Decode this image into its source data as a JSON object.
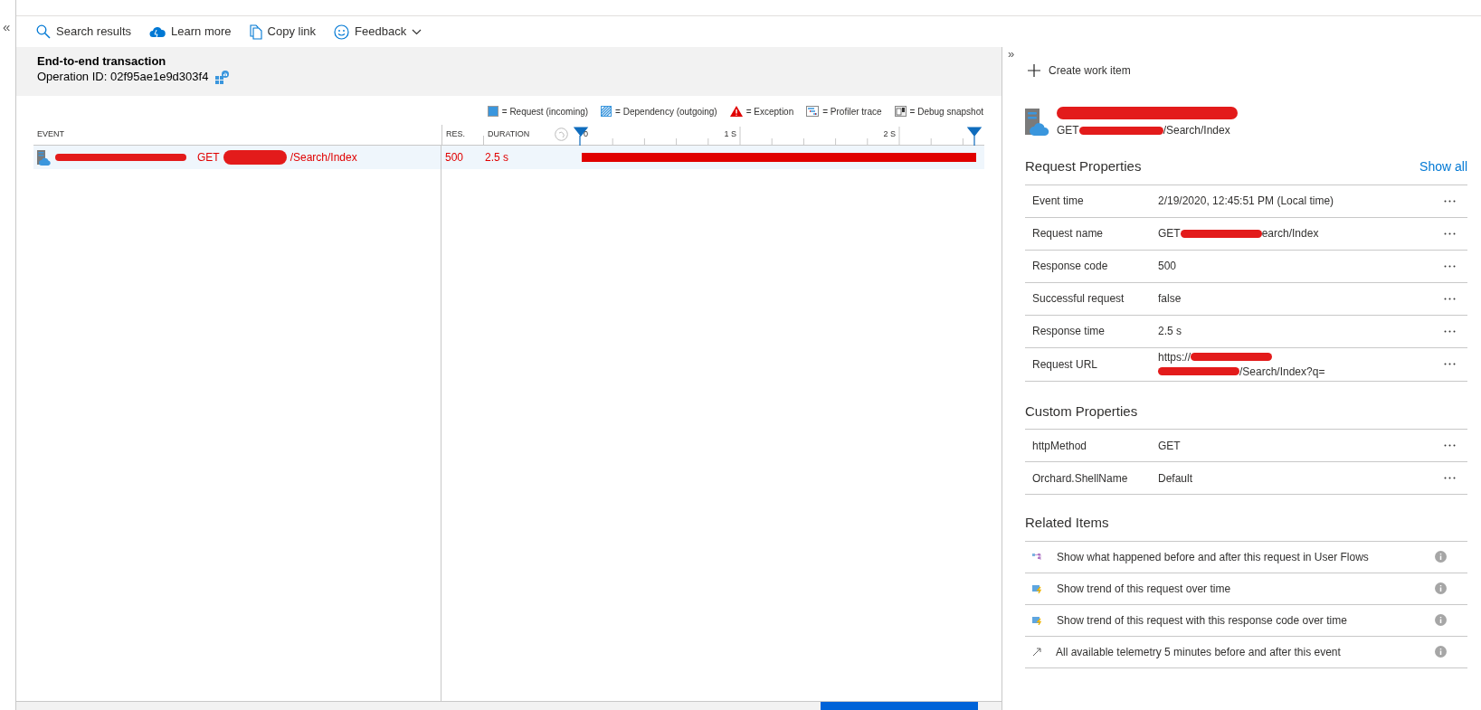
{
  "collapse_left": "«",
  "toolbar": [
    {
      "kind": "search",
      "label": "Search results"
    },
    {
      "kind": "learn",
      "label": "Learn more"
    },
    {
      "kind": "copy",
      "label": "Copy link"
    },
    {
      "kind": "feedback",
      "label": "Feedback"
    }
  ],
  "header": {
    "title": "End-to-end transaction",
    "operation_id": "Operation ID: 02f95ae1e9d303f4"
  },
  "legend": [
    {
      "kind": "request",
      "label": "= Request (incoming)"
    },
    {
      "kind": "dependency",
      "label": "= Dependency (outgoing)"
    },
    {
      "kind": "exception",
      "label": "= Exception"
    },
    {
      "kind": "profiler",
      "label": "= Profiler trace"
    },
    {
      "kind": "snapshot",
      "label": "= Debug snapshot"
    }
  ],
  "table": {
    "columns": [
      "EVENT",
      "RES.",
      "DURATION"
    ],
    "timeline_ticks": [
      "0",
      "1 S",
      "2 S"
    ],
    "rows": [
      {
        "event": [
          {
            "kind": "redacted"
          },
          {
            "kind": "text",
            "text": "GET"
          },
          {
            "kind": "redacted"
          },
          {
            "kind": "text",
            "text": "/Search/Index"
          }
        ],
        "res": "500",
        "duration": "2.5 s",
        "failed": true
      }
    ]
  },
  "details": {
    "expand": "»",
    "create": "Create work item",
    "title": [
      {
        "kind": "redacted"
      }
    ],
    "subtitle": [
      {
        "kind": "text",
        "text": "GET"
      },
      {
        "kind": "redacted"
      },
      {
        "kind": "text",
        "text": "/Search/Index"
      }
    ],
    "sections": [
      {
        "title": "Request Properties",
        "action": "Show all",
        "rows": [
          {
            "label": "Event time",
            "value": [
              [
                {
                  "kind": "text",
                  "text": "2/19/2020, 12:45:51 PM (Local time)"
                }
              ]
            ]
          },
          {
            "label": "Request name",
            "value": [
              [
                {
                  "kind": "text",
                  "text": "GET"
                },
                {
                  "kind": "redacted"
                },
                {
                  "kind": "text",
                  "text": "earch/Index"
                }
              ]
            ]
          },
          {
            "label": "Response code",
            "value": [
              [
                {
                  "kind": "text",
                  "text": "500"
                }
              ]
            ]
          },
          {
            "label": "Successful request",
            "value": [
              [
                {
                  "kind": "text",
                  "text": "false"
                }
              ]
            ]
          },
          {
            "label": "Response time",
            "value": [
              [
                {
                  "kind": "text",
                  "text": "2.5 s"
                }
              ]
            ]
          },
          {
            "label": "Request URL",
            "value": [
              [
                {
                  "kind": "text",
                  "text": "https://"
                },
                {
                  "kind": "redacted"
                }
              ],
              [
                {
                  "kind": "redacted"
                },
                {
                  "kind": "text",
                  "text": "/Search/Index?q="
                }
              ]
            ]
          }
        ]
      },
      {
        "title": "Custom Properties",
        "rows": [
          {
            "label": "httpMethod",
            "value": [
              [
                {
                  "kind": "text",
                  "text": "GET"
                }
              ]
            ]
          },
          {
            "label": "Orchard.ShellName",
            "value": [
              [
                {
                  "kind": "text",
                  "text": "Default"
                }
              ]
            ]
          }
        ]
      }
    ],
    "related_title": "Related Items",
    "related": [
      {
        "kind": "flows",
        "label": "Show what happened before and after this request in User Flows"
      },
      {
        "kind": "trend",
        "label": "Show trend of this request over time"
      },
      {
        "kind": "trend",
        "label": "Show trend of this request with this response code over time"
      },
      {
        "kind": "link",
        "label": "All available telemetry 5 minutes before and after this event"
      }
    ]
  }
}
